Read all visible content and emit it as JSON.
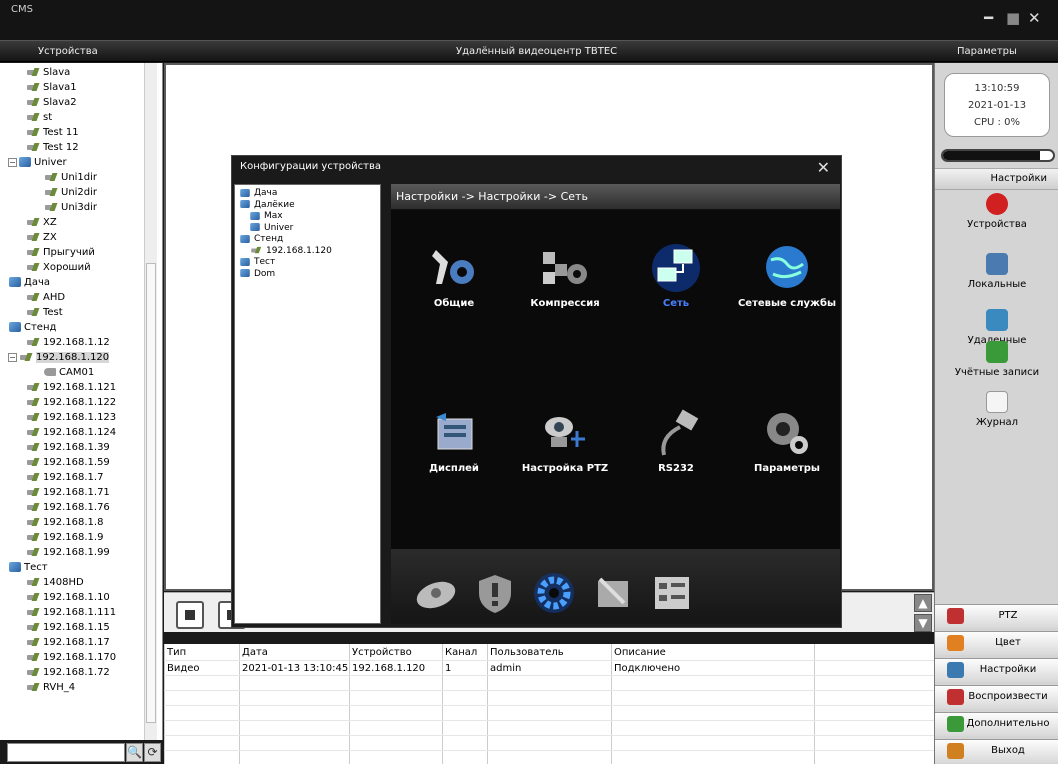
{
  "app": {
    "title": "CMS",
    "minimize": "━",
    "maximize": "■",
    "close": "✕"
  },
  "header": {
    "left": "Устройства",
    "center": "Удалённый видеоцентр TBTEC",
    "right": "Параметры"
  },
  "device_tree": [
    {
      "label": "Slava",
      "type": "device",
      "indent": 1
    },
    {
      "label": "Slava1",
      "type": "device",
      "indent": 1
    },
    {
      "label": "Slava2",
      "type": "device",
      "indent": 1
    },
    {
      "label": "st",
      "type": "device",
      "indent": 1
    },
    {
      "label": "Test 11",
      "type": "device",
      "indent": 1
    },
    {
      "label": "Test 12",
      "type": "device",
      "indent": 1
    },
    {
      "label": "Univer",
      "type": "group",
      "indent": 0,
      "toggle": "⊟"
    },
    {
      "label": "Uni1dir",
      "type": "device",
      "indent": 2
    },
    {
      "label": "Uni2dir",
      "type": "device",
      "indent": 2
    },
    {
      "label": "Uni3dir",
      "type": "device",
      "indent": 2
    },
    {
      "label": "XZ",
      "type": "device",
      "indent": 1
    },
    {
      "label": "ZX",
      "type": "device",
      "indent": 1
    },
    {
      "label": "Прыгучий",
      "type": "device",
      "indent": 1
    },
    {
      "label": "Хороший",
      "type": "device",
      "indent": 1
    },
    {
      "label": "Дача",
      "type": "group",
      "indent": 0
    },
    {
      "label": "AHD",
      "type": "device",
      "indent": 1
    },
    {
      "label": "Test",
      "type": "device",
      "indent": 1
    },
    {
      "label": "Стенд",
      "type": "group",
      "indent": 0
    },
    {
      "label": "192.168.1.12",
      "type": "device",
      "indent": 1
    },
    {
      "label": "192.168.1.120",
      "type": "device",
      "indent": 0,
      "toggle": "⊟",
      "selected": true
    },
    {
      "label": "CAM01",
      "type": "camera",
      "indent": 2
    },
    {
      "label": "192.168.1.121",
      "type": "device",
      "indent": 1
    },
    {
      "label": "192.168.1.122",
      "type": "device",
      "indent": 1
    },
    {
      "label": "192.168.1.123",
      "type": "device",
      "indent": 1
    },
    {
      "label": "192.168.1.124",
      "type": "device",
      "indent": 1
    },
    {
      "label": "192.168.1.39",
      "type": "device",
      "indent": 1
    },
    {
      "label": "192.168.1.59",
      "type": "device",
      "indent": 1
    },
    {
      "label": "192.168.1.7",
      "type": "device",
      "indent": 1
    },
    {
      "label": "192.168.1.71",
      "type": "device",
      "indent": 1
    },
    {
      "label": "192.168.1.76",
      "type": "device",
      "indent": 1
    },
    {
      "label": "192.168.1.8",
      "type": "device",
      "indent": 1
    },
    {
      "label": "192.168.1.9",
      "type": "device",
      "indent": 1
    },
    {
      "label": "192.168.1.99",
      "type": "device",
      "indent": 1
    },
    {
      "label": "Тест",
      "type": "group",
      "indent": 0
    },
    {
      "label": "1408HD",
      "type": "device",
      "indent": 1
    },
    {
      "label": "192.168.1.10",
      "type": "device",
      "indent": 1
    },
    {
      "label": "192.168.1.111",
      "type": "device",
      "indent": 1
    },
    {
      "label": "192.168.1.15",
      "type": "device",
      "indent": 1
    },
    {
      "label": "192.168.1.17",
      "type": "device",
      "indent": 1
    },
    {
      "label": "192.168.1.170",
      "type": "device",
      "indent": 1
    },
    {
      "label": "192.168.1.72",
      "type": "device",
      "indent": 1
    },
    {
      "label": "RVH_4",
      "type": "device",
      "indent": 1
    }
  ],
  "search": {
    "search_icon": "🔍",
    "refresh_icon": "⟳"
  },
  "status": {
    "time": "13:10:59",
    "date": "2021-01-13",
    "cpu": "CPU : 0%",
    "cpu_level": 0.88
  },
  "right_panel": {
    "settings_title": "Настройки",
    "items": [
      {
        "label": "Устройства",
        "icon": "record-icon",
        "color": "#d02020"
      },
      {
        "label": "Локальные",
        "icon": "local-config-icon",
        "color": "#4a7ab0"
      },
      {
        "label": "Удаленные",
        "icon": "remote-config-icon",
        "color": "#3a8ac0"
      },
      {
        "label": "Учётные записи",
        "icon": "users-icon",
        "color": "#3a9a3a"
      },
      {
        "label": "Журнал",
        "icon": "log-icon",
        "color": "#f5f5f5"
      }
    ],
    "buttons": [
      {
        "label": "PTZ",
        "icon": "ptz-icon",
        "color": "#c03030"
      },
      {
        "label": "Цвет",
        "icon": "color-icon",
        "color": "#e08020"
      },
      {
        "label": "Настройки",
        "icon": "settings-icon",
        "color": "#3a7ab0"
      },
      {
        "label": "Воспроизвести",
        "icon": "playback-icon",
        "color": "#c03030"
      },
      {
        "label": "Дополнительно",
        "icon": "advanced-icon",
        "color": "#3a9a3a"
      },
      {
        "label": "Выход",
        "icon": "exit-icon",
        "color": "#d08020"
      }
    ]
  },
  "log": {
    "columns": [
      "Тип",
      "Дата",
      "Устройство",
      "Канал",
      "Пользователь",
      "Описание"
    ],
    "rows": [
      [
        "Видео",
        "2021-01-13 13:10:45",
        "192.168.1.120",
        "1",
        "admin",
        "Подключено"
      ]
    ]
  },
  "dialog": {
    "title": "Конфигурации устройства",
    "close": "✕",
    "tree": [
      {
        "label": "Дача",
        "type": "group",
        "indent": 0
      },
      {
        "label": "Далёкие",
        "type": "group",
        "indent": 0
      },
      {
        "label": "Max",
        "type": "group",
        "indent": 1
      },
      {
        "label": "Univer",
        "type": "group",
        "indent": 1
      },
      {
        "label": "Стенд",
        "type": "group",
        "indent": 0
      },
      {
        "label": "192.168.1.120",
        "type": "device",
        "indent": 1
      },
      {
        "label": "Тест",
        "type": "group",
        "indent": 0
      },
      {
        "label": "Dom",
        "type": "group",
        "indent": 0
      }
    ],
    "breadcrumb": "Настройки -> Настройки -> Сеть",
    "modules": [
      {
        "label": "Общие",
        "icon": "general-tools-icon",
        "active": false
      },
      {
        "label": "Компрессия",
        "icon": "compression-icon",
        "active": false
      },
      {
        "label": "Сеть",
        "icon": "network-icon",
        "active": true
      },
      {
        "label": "Сетевые службы",
        "icon": "globe-icon",
        "active": false
      },
      {
        "label": "Дисплей",
        "icon": "display-icon",
        "active": false
      },
      {
        "label": "Настройка PTZ",
        "icon": "ptz-camera-icon",
        "active": false
      },
      {
        "label": "RS232",
        "icon": "rs232-cable-icon",
        "active": false
      },
      {
        "label": "Параметры",
        "icon": "webcam-gear-icon",
        "active": false
      }
    ],
    "toolbar": [
      {
        "icon": "storage-disk-icon"
      },
      {
        "icon": "security-shield-icon"
      },
      {
        "icon": "gear-settings-icon",
        "active": true
      },
      {
        "icon": "tools-icon"
      },
      {
        "icon": "info-list-icon"
      }
    ]
  }
}
